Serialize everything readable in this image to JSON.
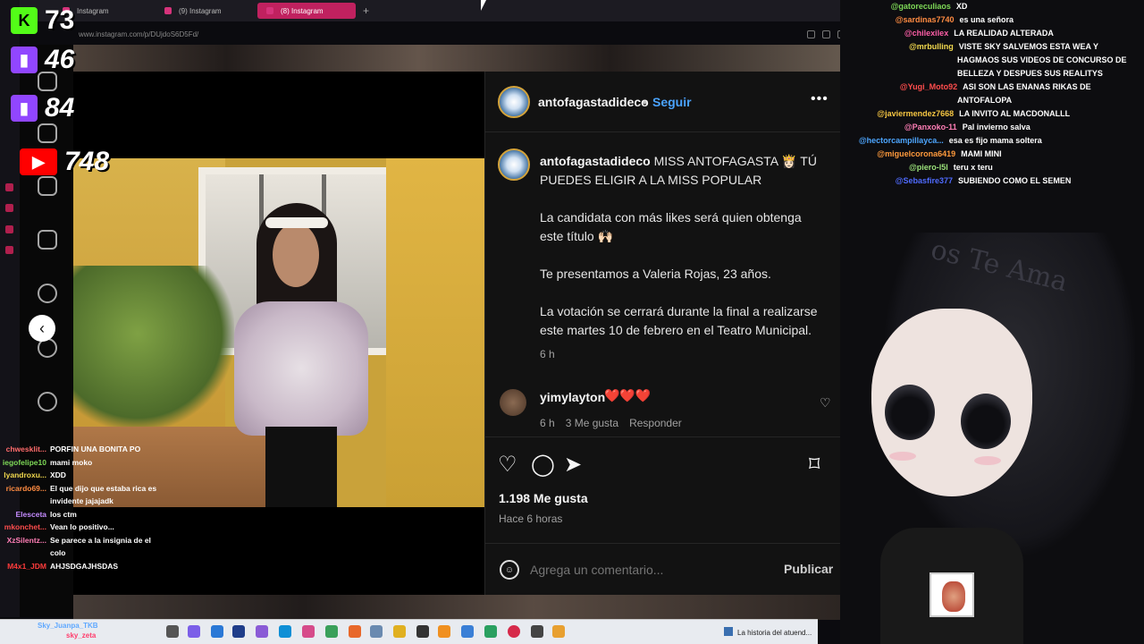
{
  "browser": {
    "tabs": [
      {
        "label": "Instagram",
        "active": false
      },
      {
        "label": "(9) Instagram",
        "active": false
      },
      {
        "label": "(8) Instagram",
        "active": true
      }
    ],
    "new_tab": "+",
    "url": "www.instagram.com/p/DUjdoS6D5Fd/"
  },
  "counters": [
    {
      "badge": "K",
      "value": "73",
      "color": "#53fc18"
    },
    {
      "badge": "",
      "value": "46",
      "color": "#9146ff",
      "icon": "twitch-icon"
    },
    {
      "badge": "",
      "value": "84",
      "color": "#9146ff",
      "icon": "twitch-icon"
    },
    {
      "badge": "▶",
      "value": "748",
      "color": "#ff0000",
      "icon": "youtube-icon"
    }
  ],
  "post": {
    "account": "antofagastadideco",
    "follow": "Seguir",
    "more": "•••",
    "caption_user": "antofagastadideco",
    "caption_first": "MISS ANTOFAGASTA 👸🏻 TÚ PUEDES ELIGIR A LA MISS POPULAR",
    "caption_p2": "La candidata con más likes será quien obtenga este título 🙌🏻",
    "caption_p3": "Te presentamos a Valeria Rojas, 23 años.",
    "caption_p4": "La votación se cerrará durante la final a realizarse este martes 10 de febrero en el Teatro Municipal.",
    "caption_time": "6 h",
    "comment": {
      "user": "yimylayton",
      "text": "❤️❤️❤️",
      "time": "6 h",
      "likes": "3 Me gusta",
      "reply": "Responder"
    },
    "likes": "1.198 Me gusta",
    "ago": "Hace 6 horas",
    "comment_placeholder": "Agrega un comentario...",
    "publish": "Publicar",
    "close": "✕",
    "prev": "‹",
    "next": "›"
  },
  "right_chat": [
    {
      "user": "@gatoreculiaos",
      "msg": "XD",
      "color": "#7ed957"
    },
    {
      "user": "@sardinas7740",
      "msg": "es una señora",
      "color": "#ff8c42"
    },
    {
      "user": "@chilexilex",
      "msg": "LA REALIDAD ALTERADA",
      "color": "#ff5fa8"
    },
    {
      "user": "@mrbulling",
      "msg": "VISTE SKY SALVEMOS ESTA WEA Y",
      "color": "#f2d94e"
    },
    {
      "user": "",
      "msg": "HAGMAOS SUS VIDEOS DE CONCURSO DE",
      "color": "#fff"
    },
    {
      "user": "",
      "msg": "BELLEZA Y DESPUES SUS REALITYS",
      "color": "#fff"
    },
    {
      "user": "@Yugi_Moto92",
      "msg": "ASI SON LAS ENANAS RIKAS DE",
      "color": "#ff4d4d"
    },
    {
      "user": "",
      "msg": "ANTOFALOPA",
      "color": "#fff"
    },
    {
      "user": "@javiermendez7668",
      "msg": "LA INVITO AL MACDONALLL",
      "color": "#f5c542"
    },
    {
      "user": "@Panxoko-11",
      "msg": "Pal invierno salva",
      "color": "#ff7eb6"
    },
    {
      "user": "@hectorcampillayca...",
      "msg": "esa es fijo mama soltera",
      "color": "#4da6ff"
    },
    {
      "user": "@miguelcorona6419",
      "msg": "MAMI MINI",
      "color": "#ff9a3c"
    },
    {
      "user": "@piero-l5l",
      "msg": "teru x teru",
      "color": "#9be27a"
    },
    {
      "user": "@Sebasfire377",
      "msg": "SUBIENDO COMO EL SEMEN",
      "color": "#4f6bff"
    }
  ],
  "left_chat": [
    {
      "user": "chwesklit...",
      "msg": "PORFIN UNA BONITA PO",
      "color": "#ff6b6b"
    },
    {
      "user": "iegofelipe10",
      "msg": "mami moko",
      "color": "#7ed957"
    },
    {
      "user": "lyandroxu...",
      "msg": "XDD",
      "color": "#f2d94e"
    },
    {
      "user": "ricardo69...",
      "msg": "El que dijo que estaba rica es",
      "color": "#ff8c42"
    },
    {
      "user": "",
      "msg": "invidente jajajadk",
      "color": "#fff"
    },
    {
      "user": "Elesceta",
      "msg": "los ctm",
      "color": "#c58cff"
    },
    {
      "user": "mkonchet...",
      "msg": "Vean lo positivo...",
      "color": "#ff4d4d"
    },
    {
      "user": "XzSilentz...",
      "msg": "Se parece a la insignia de el",
      "color": "#ff7eb6"
    },
    {
      "user": "",
      "msg": "colo",
      "color": "#fff"
    },
    {
      "user": "M4x1_JDM",
      "msg": "AHJSDGAJHSDAS",
      "color": "#ff3b3b"
    }
  ],
  "avatar_text": "os Te Ama",
  "taskbar": {
    "users": [
      "Sky_Juanpa_TKB",
      "sky_zeta"
    ],
    "running_label": "La historia del atuend..."
  }
}
